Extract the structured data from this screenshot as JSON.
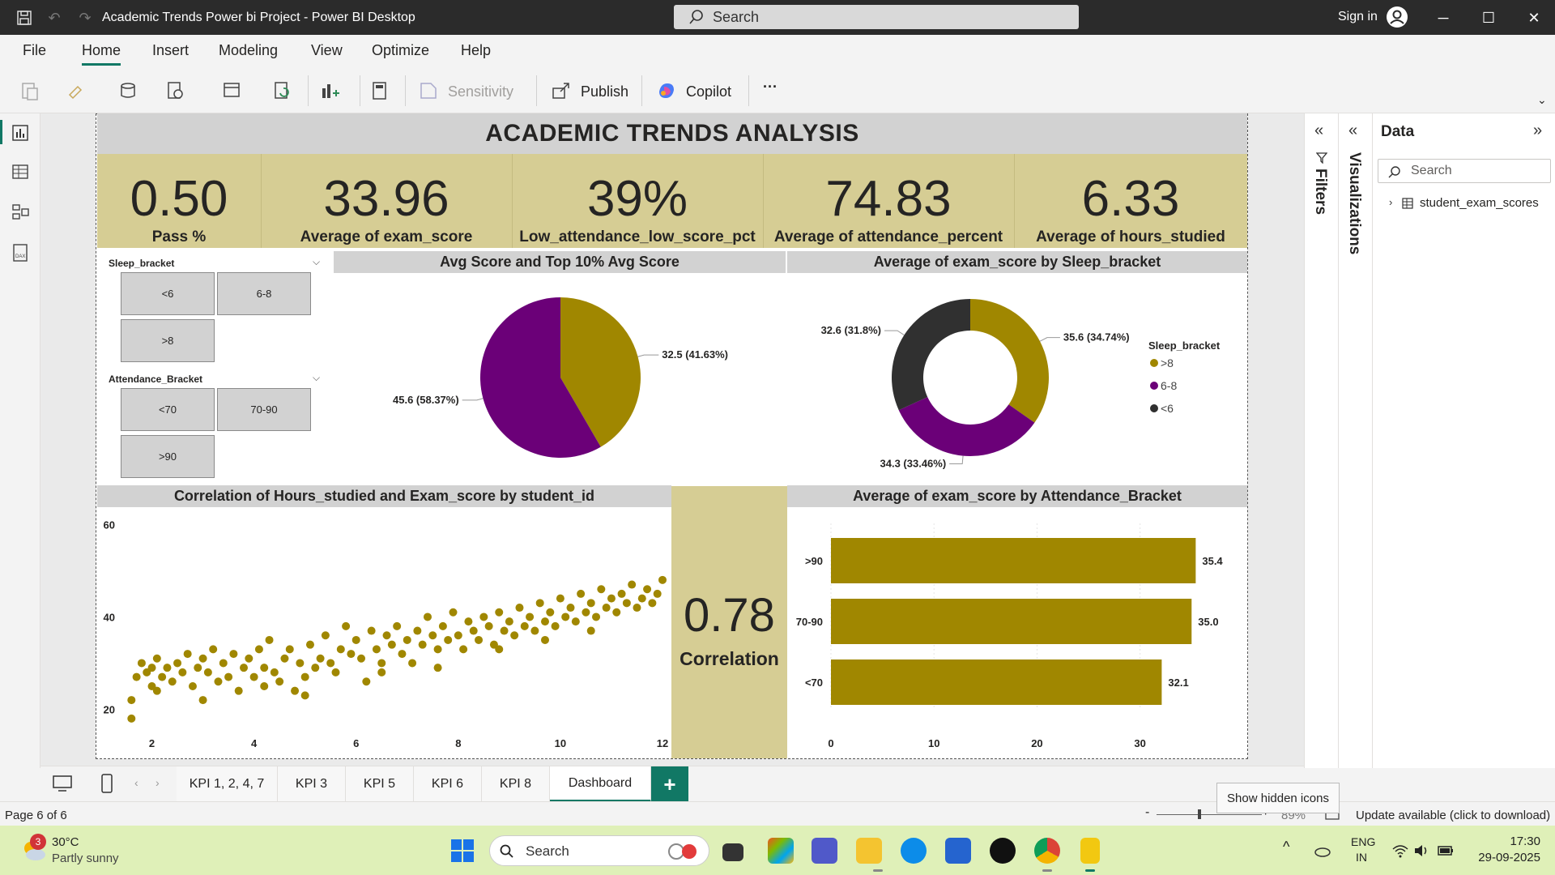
{
  "window": {
    "title": "Academic Trends Power bi Project - Power BI Desktop",
    "search_placeholder": "Search",
    "signin": "Sign in"
  },
  "menu": [
    "File",
    "Home",
    "Insert",
    "Modeling",
    "View",
    "Optimize",
    "Help"
  ],
  "ribbon": {
    "sensitivity": "Sensitivity",
    "publish": "Publish",
    "copilot": "Copilot",
    "more": "···"
  },
  "report": {
    "title": "ACADEMIC TRENDS ANALYSIS",
    "kpis": [
      {
        "value": "0.50",
        "label": "Pass %"
      },
      {
        "value": "33.96",
        "label": "Average of exam_score"
      },
      {
        "value": "39%",
        "label": "Low_attendance_low_score_pct"
      },
      {
        "value": "74.83",
        "label": "Average of attendance_percent"
      },
      {
        "value": "6.33",
        "label": "Average of hours_studied"
      }
    ],
    "sleep_slicer": {
      "title": "Sleep_bracket",
      "options": [
        "<6",
        "6-8",
        ">8"
      ]
    },
    "attendance_slicer": {
      "title": "Attendance_Bracket",
      "options": [
        "<70",
        "70-90",
        ">90"
      ]
    },
    "correlation": {
      "value": "0.78",
      "label": "Correlation"
    }
  },
  "chart_data": [
    {
      "type": "pie",
      "title": "Avg Score and Top 10% Avg Score",
      "slices": [
        {
          "value": 32.5,
          "label": "32.5 (41.63%)",
          "color": "#a08700"
        },
        {
          "value": 45.6,
          "label": "45.6 (58.37%)",
          "color": "#6b0078"
        }
      ]
    },
    {
      "type": "pie",
      "subtype": "donut",
      "title": "Average of exam_score by Sleep_bracket",
      "legend_title": "Sleep_bracket",
      "legend_position": "right",
      "slices": [
        {
          "name": ">8",
          "value": 35.6,
          "label": "35.6 (34.74%)",
          "color": "#a08700"
        },
        {
          "name": "6-8",
          "value": 34.3,
          "label": "34.3 (33.46%)",
          "color": "#6b0078"
        },
        {
          "name": "<6",
          "value": 32.6,
          "label": "32.6 (31.8%)",
          "color": "#303030"
        }
      ]
    },
    {
      "type": "scatter",
      "title": "Correlation of Hours_studied and Exam_score by student_id",
      "x_ticks": [
        "2",
        "4",
        "6",
        "8",
        "10",
        "12"
      ],
      "y_ticks": [
        "20",
        "40",
        "60"
      ],
      "xlim": [
        1.5,
        12
      ],
      "ylim": [
        15,
        62
      ],
      "color": "#a08700",
      "points": [
        [
          1.6,
          18
        ],
        [
          1.6,
          22
        ],
        [
          1.7,
          27
        ],
        [
          1.8,
          30
        ],
        [
          1.9,
          28
        ],
        [
          2,
          25
        ],
        [
          2,
          29
        ],
        [
          2.1,
          31
        ],
        [
          2.2,
          27
        ],
        [
          2.3,
          29
        ],
        [
          2.4,
          26
        ],
        [
          2.5,
          30
        ],
        [
          2.6,
          28
        ],
        [
          2.7,
          32
        ],
        [
          2.8,
          25
        ],
        [
          2.9,
          29
        ],
        [
          3,
          31
        ],
        [
          3.1,
          28
        ],
        [
          3.2,
          33
        ],
        [
          3.3,
          26
        ],
        [
          3.4,
          30
        ],
        [
          3.5,
          27
        ],
        [
          3.6,
          32
        ],
        [
          3.7,
          24
        ],
        [
          3.8,
          29
        ],
        [
          3.9,
          31
        ],
        [
          4,
          27
        ],
        [
          4.1,
          33
        ],
        [
          4.2,
          29
        ],
        [
          4.3,
          35
        ],
        [
          4.4,
          28
        ],
        [
          4.5,
          26
        ],
        [
          4.6,
          31
        ],
        [
          4.7,
          33
        ],
        [
          4.8,
          24
        ],
        [
          4.9,
          30
        ],
        [
          5,
          27
        ],
        [
          5.1,
          34
        ],
        [
          5.2,
          29
        ],
        [
          5.3,
          31
        ],
        [
          5.4,
          36
        ],
        [
          5.5,
          30
        ],
        [
          5.6,
          28
        ],
        [
          5.7,
          33
        ],
        [
          5.8,
          38
        ],
        [
          5.9,
          32
        ],
        [
          6,
          35
        ],
        [
          6.1,
          31
        ],
        [
          6.2,
          26
        ],
        [
          6.3,
          37
        ],
        [
          6.4,
          33
        ],
        [
          6.5,
          30
        ],
        [
          6.6,
          36
        ],
        [
          6.7,
          34
        ],
        [
          6.8,
          38
        ],
        [
          6.9,
          32
        ],
        [
          7,
          35
        ],
        [
          7.1,
          30
        ],
        [
          7.2,
          37
        ],
        [
          7.3,
          34
        ],
        [
          7.4,
          40
        ],
        [
          7.5,
          36
        ],
        [
          7.6,
          33
        ],
        [
          7.7,
          38
        ],
        [
          7.8,
          35
        ],
        [
          7.9,
          41
        ],
        [
          8,
          36
        ],
        [
          8.1,
          33
        ],
        [
          8.2,
          39
        ],
        [
          8.3,
          37
        ],
        [
          8.4,
          35
        ],
        [
          8.5,
          40
        ],
        [
          8.6,
          38
        ],
        [
          8.7,
          34
        ],
        [
          8.8,
          41
        ],
        [
          8.9,
          37
        ],
        [
          9,
          39
        ],
        [
          9.1,
          36
        ],
        [
          9.2,
          42
        ],
        [
          9.3,
          38
        ],
        [
          9.4,
          40
        ],
        [
          9.5,
          37
        ],
        [
          9.6,
          43
        ],
        [
          9.7,
          39
        ],
        [
          9.8,
          41
        ],
        [
          9.9,
          38
        ],
        [
          10,
          44
        ],
        [
          10.1,
          40
        ],
        [
          10.2,
          42
        ],
        [
          10.3,
          39
        ],
        [
          10.4,
          45
        ],
        [
          10.5,
          41
        ],
        [
          10.6,
          43
        ],
        [
          10.7,
          40
        ],
        [
          10.8,
          46
        ],
        [
          10.9,
          42
        ],
        [
          11,
          44
        ],
        [
          11.1,
          41
        ],
        [
          11.2,
          45
        ],
        [
          11.3,
          43
        ],
        [
          11.4,
          47
        ],
        [
          11.5,
          42
        ],
        [
          11.6,
          44
        ],
        [
          11.7,
          46
        ],
        [
          11.8,
          43
        ],
        [
          11.9,
          45
        ],
        [
          12,
          48
        ],
        [
          2.1,
          24
        ],
        [
          3,
          22
        ],
        [
          4.2,
          25
        ],
        [
          5,
          23
        ],
        [
          6.5,
          28
        ],
        [
          7.6,
          29
        ],
        [
          8.8,
          33
        ],
        [
          9.7,
          35
        ],
        [
          10.6,
          37
        ]
      ]
    },
    {
      "type": "bar",
      "orientation": "horizontal",
      "title": "Average of exam_score by Attendance_Bracket",
      "categories": [
        ">90",
        "70-90",
        "<70"
      ],
      "values": [
        35.4,
        35.0,
        32.1
      ],
      "labels": [
        "35.4",
        "35.0",
        "32.1"
      ],
      "x_ticks": [
        "0",
        "10",
        "20",
        "30"
      ],
      "xlim": [
        0,
        36
      ],
      "color": "#a08700"
    }
  ],
  "panes": {
    "filters": "Filters",
    "visualizations": "Visualizations",
    "data_title": "Data",
    "data_search": "Search",
    "table": "student_exam_scores"
  },
  "pages": {
    "tabs": [
      "KPI 1, 2, 4, 7",
      "KPI 3",
      "KPI 5",
      "KPI 6",
      "KPI 8",
      "Dashboard"
    ],
    "active": "Dashboard"
  },
  "status": {
    "page": "Page 6 of 6",
    "zoom": "89%",
    "update": "Update available (click to download)",
    "tooltip": "Show hidden icons"
  },
  "taskbar": {
    "weather_temp": "30°C",
    "weather_desc": "Partly sunny",
    "weather_badge": "3",
    "search": "Search",
    "lang1": "ENG",
    "lang2": "IN",
    "time": "17:30",
    "date": "29-09-2025"
  }
}
